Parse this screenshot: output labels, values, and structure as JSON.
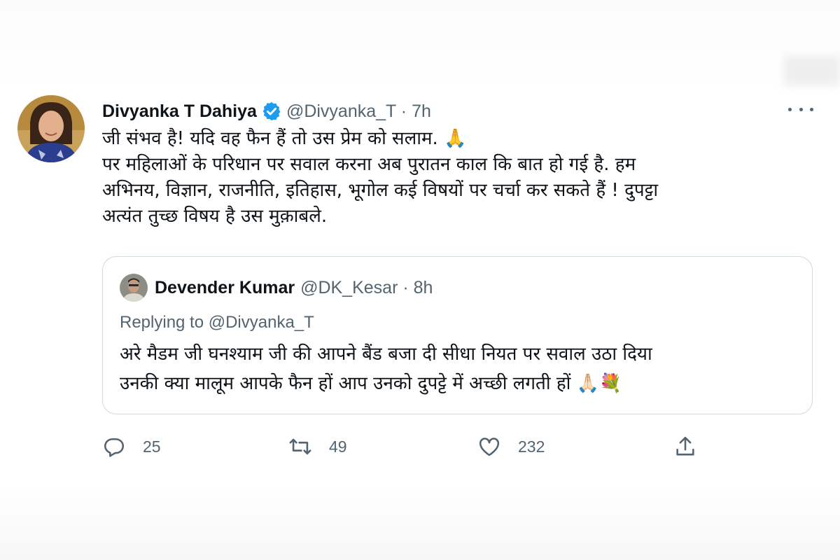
{
  "tweet": {
    "author": {
      "name": "Divyanka T Dahiya",
      "handle_time": "@Divyanka_T · 7h",
      "verified": true
    },
    "text_lines": [
      "जी संभव है! यदि वह फैन हैं तो उस प्रेम को सलाम. 🙏",
      "पर महिलाओं के परिधान पर सवाल करना अब पुरातन काल कि बात हो गई है. हम",
      "अभिनय, विज्ञान, राजनीति, इतिहास, भूगोल कई विषयों पर चर्चा कर सकते हैं ! दुपट्टा",
      "अत्यंत तुच्छ विषय है उस मुक़ाबले."
    ],
    "quoted": {
      "name": "Devender Kumar",
      "handle_time": "@DK_Kesar · 8h",
      "replying_to": "Replying to @Divyanka_T",
      "text_lines": [
        "अरे मैडम जी घनश्याम जी की आपने बैंड बजा दी सीधा नियत पर सवाल उठा दिया",
        "उनकी क्या मालूम आपके फैन हों आप उनको दुपट्टे में अच्छी लगती हों 🙏🏻💐"
      ]
    },
    "actions": {
      "reply_count": "25",
      "retweet_count": "49",
      "like_count": "232"
    },
    "icons": [
      "verified-badge-icon",
      "more-icon",
      "reply-icon",
      "retweet-icon",
      "like-icon",
      "share-icon"
    ],
    "colors": {
      "accent": "#1d9bf0",
      "text": "#0f1419",
      "secondary": "#536471",
      "border": "#cfd9de"
    }
  }
}
